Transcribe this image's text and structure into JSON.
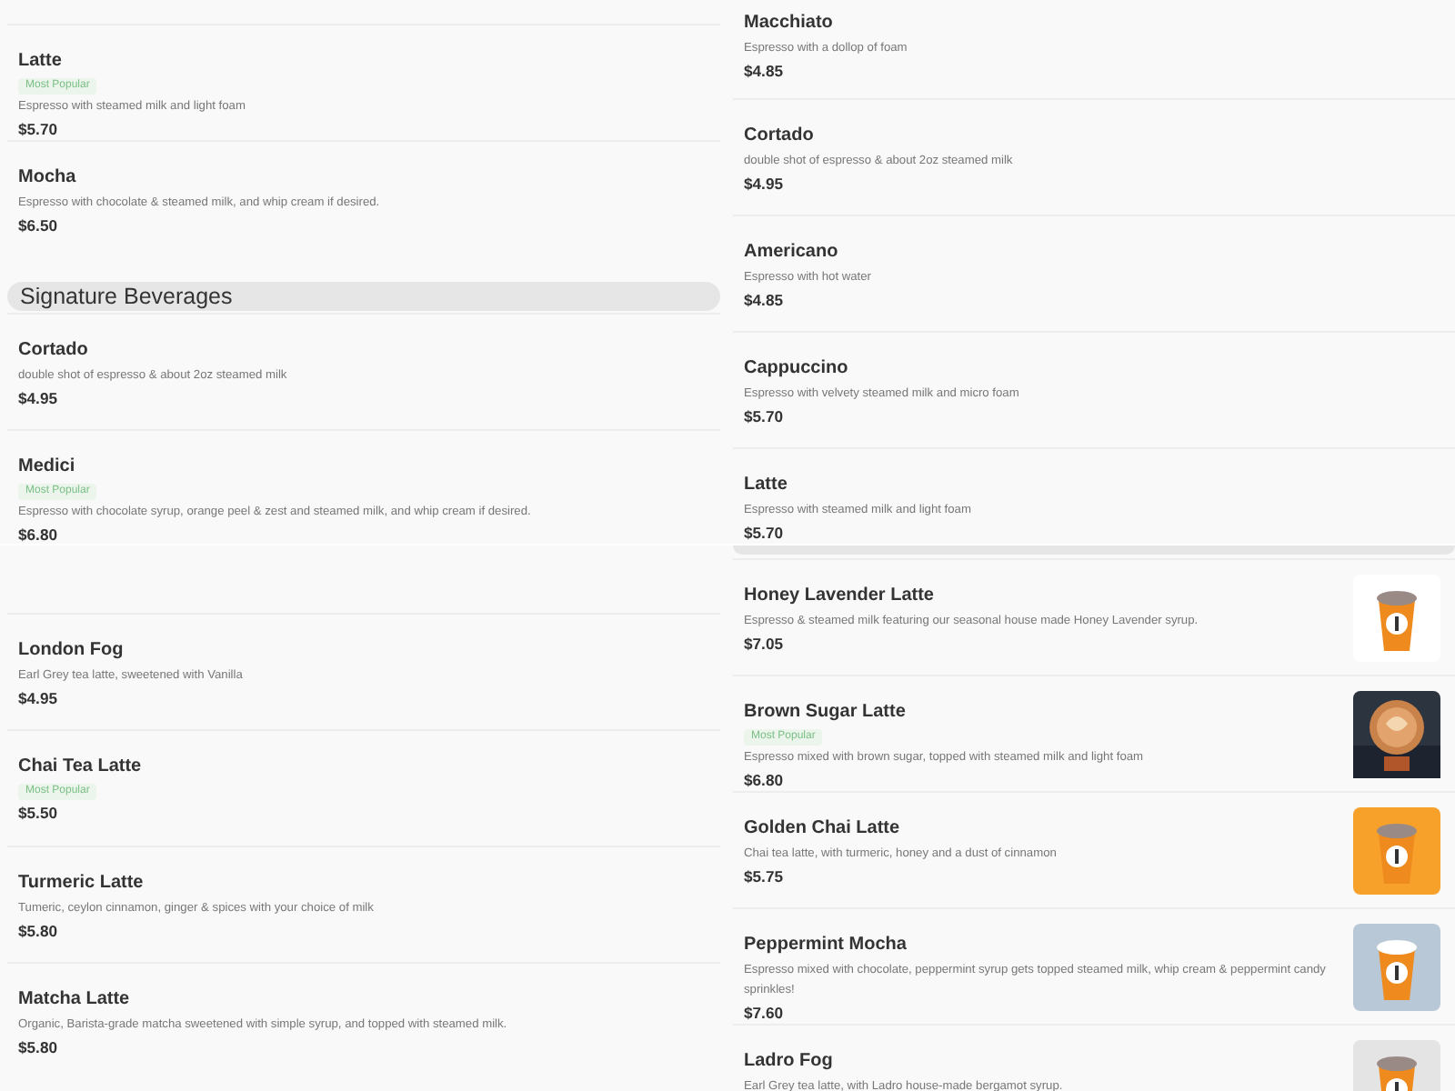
{
  "panels": [
    {
      "entries": [
        {
          "kind": "item",
          "name": "Latte",
          "badge": "Most Popular",
          "description": "Espresso with steamed milk and light foam",
          "price": "$5.70"
        },
        {
          "kind": "item",
          "name": "Mocha",
          "description": "Espresso with chocolate & steamed milk, and whip cream if desired.",
          "price": "$6.50"
        },
        {
          "kind": "header",
          "title": "Signature Beverages"
        },
        {
          "kind": "item",
          "name": "Cortado",
          "description": "double shot of espresso & about 2oz steamed milk",
          "price": "$4.95"
        },
        {
          "kind": "item",
          "name": "Medici",
          "badge": "Most Popular",
          "description": "Espresso with chocolate syrup, orange peel & zest and steamed milk, and whip cream if desired.",
          "price": "$6.80"
        }
      ]
    },
    {
      "entries": [
        {
          "kind": "item",
          "name": "Macchiato",
          "description": "Espresso with a dollop of foam",
          "price": "$4.85"
        },
        {
          "kind": "item",
          "name": "Cortado",
          "description": "double shot of espresso & about 2oz steamed milk",
          "price": "$4.95"
        },
        {
          "kind": "item",
          "name": "Americano",
          "description": "Espresso with hot water",
          "price": "$4.85"
        },
        {
          "kind": "item",
          "name": "Cappuccino",
          "description": "Espresso with velvety steamed milk and micro foam",
          "price": "$5.70"
        },
        {
          "kind": "item",
          "name": "Latte",
          "description": "Espresso with steamed milk and light foam",
          "price": "$5.70"
        }
      ]
    },
    {
      "entries": [
        {
          "kind": "item",
          "name": "London Fog",
          "description": "Earl Grey tea latte, sweetened with Vanilla",
          "price": "$4.95"
        },
        {
          "kind": "item",
          "name": "Chai Tea Latte",
          "badge": "Most Popular",
          "price": "$5.50"
        },
        {
          "kind": "item",
          "name": "Turmeric Latte",
          "description": "Tumeric, ceylon cinnamon, ginger & spices with your choice of milk",
          "price": "$5.80"
        },
        {
          "kind": "item",
          "name": "Matcha Latte",
          "description": "Organic, Barista-grade matcha sweetened with simple syrup, and topped with steamed milk.",
          "price": "$5.80"
        }
      ]
    },
    {
      "entries": [
        {
          "kind": "header_cut"
        },
        {
          "kind": "item",
          "name": "Honey Lavender Latte",
          "description": "Espresso & steamed milk featuring our seasonal house made Honey Lavender syrup.",
          "price": "$7.05"
        },
        {
          "kind": "item",
          "name": "Brown Sugar Latte",
          "badge": "Most Popular",
          "description": "Espresso mixed with brown sugar, topped with steamed milk and light foam",
          "price": "$6.80"
        },
        {
          "kind": "item",
          "name": "Golden Chai Latte",
          "description": "Chai tea latte, with turmeric, honey and a dust of cinnamon",
          "price": "$5.75"
        },
        {
          "kind": "item",
          "name": "Peppermint Mocha",
          "description": "Espresso mixed with chocolate, peppermint syrup gets topped steamed milk, whip cream & peppermint candy sprinkles!",
          "price": "$7.60"
        },
        {
          "kind": "item",
          "name": "Ladro Fog",
          "description": "Earl Grey tea latte, with Ladro house-made bergamot syrup."
        }
      ]
    }
  ]
}
